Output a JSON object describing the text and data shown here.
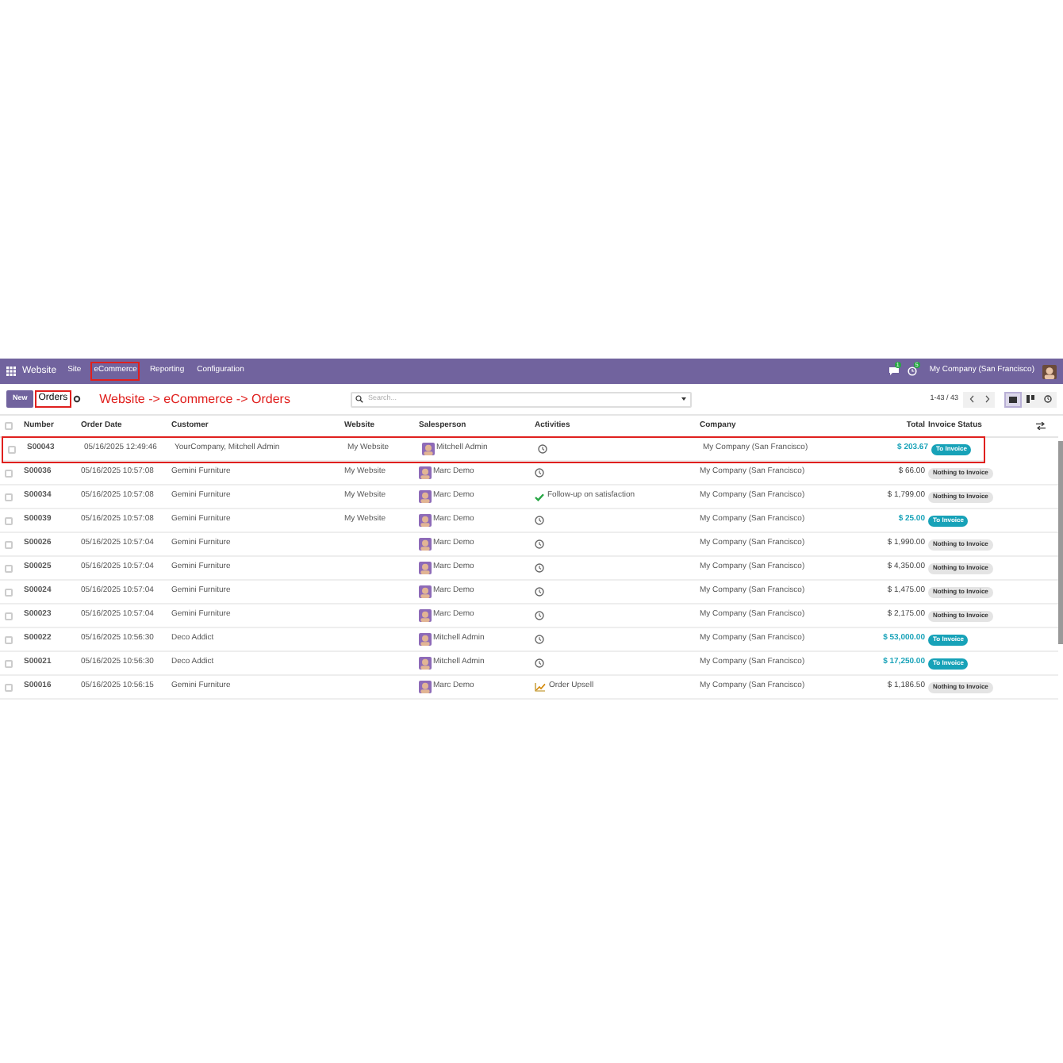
{
  "navbar": {
    "app": "Website",
    "menu": [
      {
        "label": "Site",
        "highlighted": false
      },
      {
        "label": "eCommerce",
        "highlighted": true
      },
      {
        "label": "Reporting",
        "highlighted": false
      },
      {
        "label": "Configuration",
        "highlighted": false
      }
    ],
    "messages_count": "1",
    "activities_count": "5",
    "company": "My Company (San Francisco)"
  },
  "control_panel": {
    "new_button": "New",
    "breadcrumb": "Orders",
    "breadcrumb_highlighted": true,
    "annotation": "Website -> eCommerce -> Orders",
    "search": {
      "placeholder": "Search..."
    },
    "pager": "1-43 / 43",
    "views": [
      {
        "kind": "list",
        "selected": true
      },
      {
        "kind": "kanban",
        "selected": false
      },
      {
        "kind": "activity",
        "selected": false
      }
    ]
  },
  "table": {
    "columns": [
      "Number",
      "Order Date",
      "Customer",
      "Website",
      "Salesperson",
      "Activities",
      "Company",
      "Total",
      "Invoice Status"
    ],
    "all_checked": false,
    "rows": [
      {
        "number": "S00043",
        "date": "05/16/2025 12:49:46",
        "customer": "YourCompany, Mitchell Admin",
        "website": "My Website",
        "salesperson": "Mitchell Admin",
        "activity": {
          "kind": "clock"
        },
        "company": "My Company (San Francisco)",
        "total": "$ 203.67",
        "status": {
          "kind": "to_invoice",
          "label": "To Invoice"
        },
        "highlighted": true,
        "checked": false
      },
      {
        "number": "S00036",
        "date": "05/16/2025 10:57:08",
        "customer": "Gemini Furniture",
        "website": "My Website",
        "salesperson": "Marc Demo",
        "activity": {
          "kind": "clock"
        },
        "company": "My Company (San Francisco)",
        "total": "$ 66.00",
        "status": {
          "kind": "nothing",
          "label": "Nothing to Invoice"
        },
        "highlighted": false,
        "checked": false
      },
      {
        "number": "S00034",
        "date": "05/16/2025 10:57:08",
        "customer": "Gemini Furniture",
        "website": "My Website",
        "salesperson": "Marc Demo",
        "activity": {
          "kind": "check",
          "label": "Follow-up on satisfaction"
        },
        "company": "My Company (San Francisco)",
        "total": "$ 1,799.00",
        "status": {
          "kind": "nothing",
          "label": "Nothing to Invoice"
        },
        "highlighted": false,
        "checked": false
      },
      {
        "number": "S00039",
        "date": "05/16/2025 10:57:08",
        "customer": "Gemini Furniture",
        "website": "My Website",
        "salesperson": "Marc Demo",
        "activity": {
          "kind": "clock"
        },
        "company": "My Company (San Francisco)",
        "total": "$ 25.00",
        "status": {
          "kind": "to_invoice",
          "label": "To Invoice"
        },
        "highlighted": false,
        "checked": false
      },
      {
        "number": "S00026",
        "date": "05/16/2025 10:57:04",
        "customer": "Gemini Furniture",
        "salesperson": "Marc Demo",
        "activity": {
          "kind": "clock"
        },
        "company": "My Company (San Francisco)",
        "total": "$ 1,990.00",
        "status": {
          "kind": "nothing",
          "label": "Nothing to Invoice"
        },
        "highlighted": false,
        "checked": false
      },
      {
        "number": "S00025",
        "date": "05/16/2025 10:57:04",
        "customer": "Gemini Furniture",
        "salesperson": "Marc Demo",
        "activity": {
          "kind": "clock"
        },
        "company": "My Company (San Francisco)",
        "total": "$ 4,350.00",
        "status": {
          "kind": "nothing",
          "label": "Nothing to Invoice"
        },
        "highlighted": false,
        "checked": false
      },
      {
        "number": "S00024",
        "date": "05/16/2025 10:57:04",
        "customer": "Gemini Furniture",
        "salesperson": "Marc Demo",
        "activity": {
          "kind": "clock"
        },
        "company": "My Company (San Francisco)",
        "total": "$ 1,475.00",
        "status": {
          "kind": "nothing",
          "label": "Nothing to Invoice"
        },
        "highlighted": false,
        "checked": false
      },
      {
        "number": "S00023",
        "date": "05/16/2025 10:57:04",
        "customer": "Gemini Furniture",
        "salesperson": "Marc Demo",
        "activity": {
          "kind": "clock"
        },
        "company": "My Company (San Francisco)",
        "total": "$ 2,175.00",
        "status": {
          "kind": "nothing",
          "label": "Nothing to Invoice"
        },
        "highlighted": false,
        "checked": false
      },
      {
        "number": "S00022",
        "date": "05/16/2025 10:56:30",
        "customer": "Deco Addict",
        "salesperson": "Mitchell Admin",
        "activity": {
          "kind": "clock"
        },
        "company": "My Company (San Francisco)",
        "total": "$ 53,000.00",
        "status": {
          "kind": "to_invoice",
          "label": "To Invoice"
        },
        "highlighted": false,
        "checked": false
      },
      {
        "number": "S00021",
        "date": "05/16/2025 10:56:30",
        "customer": "Deco Addict",
        "salesperson": "Mitchell Admin",
        "activity": {
          "kind": "clock"
        },
        "company": "My Company (San Francisco)",
        "total": "$ 17,250.00",
        "status": {
          "kind": "to_invoice",
          "label": "To Invoice"
        },
        "highlighted": false,
        "checked": false
      },
      {
        "number": "S00016",
        "date": "05/16/2025 10:56:15",
        "customer": "Gemini Furniture",
        "salesperson": "Marc Demo",
        "activity": {
          "kind": "chart",
          "label": "Order Upsell"
        },
        "company": "My Company (San Francisco)",
        "total": "$ 1,186.50",
        "status": {
          "kind": "nothing",
          "label": "Nothing to Invoice"
        },
        "highlighted": false,
        "checked": false
      }
    ]
  }
}
